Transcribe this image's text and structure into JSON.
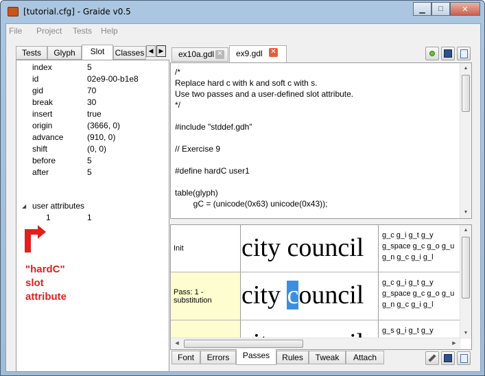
{
  "window": {
    "title": "[tutorial.cfg] - Graide v0.5",
    "minimize": "▁",
    "maximize": "□",
    "close": "✕"
  },
  "menu": {
    "items": [
      "File",
      "Project",
      "Tests",
      "Help"
    ]
  },
  "left_tabs": [
    "Tests",
    "Glyph",
    "Slot",
    "Classes"
  ],
  "left_tabs_active": "Slot",
  "slot_properties": [
    {
      "name": "index",
      "value": "5"
    },
    {
      "name": "id",
      "value": "02e9-00-b1e8"
    },
    {
      "name": "gid",
      "value": "70"
    },
    {
      "name": "break",
      "value": "30"
    },
    {
      "name": "insert",
      "value": "true"
    },
    {
      "name": "origin",
      "value": "(3666, 0)"
    },
    {
      "name": "advance",
      "value": "(910, 0)"
    },
    {
      "name": "shift",
      "value": "(0, 0)"
    },
    {
      "name": "before",
      "value": "5"
    },
    {
      "name": "after",
      "value": "5"
    }
  ],
  "user_attributes": {
    "label": "user attributes",
    "rows": [
      {
        "name": "1",
        "value": "1"
      }
    ]
  },
  "annotation": [
    "\"hardC\"",
    "slot",
    "attribute"
  ],
  "annotation_color": "#e0201c",
  "editor_tabs": [
    {
      "label": "ex10a.gdl",
      "active": false
    },
    {
      "label": "ex9.gdl",
      "active": true
    }
  ],
  "editor_lines": [
    "/*",
    "Replace hard c with k and soft c with s.",
    "Use two passes and a user-defined slot attribute.",
    "*/",
    "",
    "#include \"stddef.gdh\"",
    "",
    "// Exercise 9",
    "",
    "#define hardC user1",
    "",
    "table(glyph)",
    "        gC = (unicode(0x63) unicode(0x43));"
  ],
  "passes": [
    {
      "label": "Init",
      "glyphs_before": "city council",
      "highlight": "",
      "glyphs_after": "",
      "names": "g_c g_i g_t g_y g_space g_c g_o g_u g_n g_c g_i g_l",
      "highlighted_row": false
    },
    {
      "label": "Pass: 1 - substitution",
      "glyphs_before": "city ",
      "highlight": "c",
      "glyphs_after": "ouncil",
      "names": "g_c g_i g_t g_y g_space g_c g_o g_u g_n g_c g_i g_l",
      "highlighted_row": true
    },
    {
      "label": "",
      "glyphs_before": "city council",
      "highlight": "",
      "glyphs_after": "",
      "names": "g_s g_i g_t g_y g_space g_k g_o g_u g_n g_s g_i g_l",
      "highlighted_row": true
    }
  ],
  "bottom_tabs": [
    "Font",
    "Errors",
    "Passes",
    "Rules",
    "Tweak",
    "Attach"
  ],
  "bottom_tabs_active": "Passes"
}
